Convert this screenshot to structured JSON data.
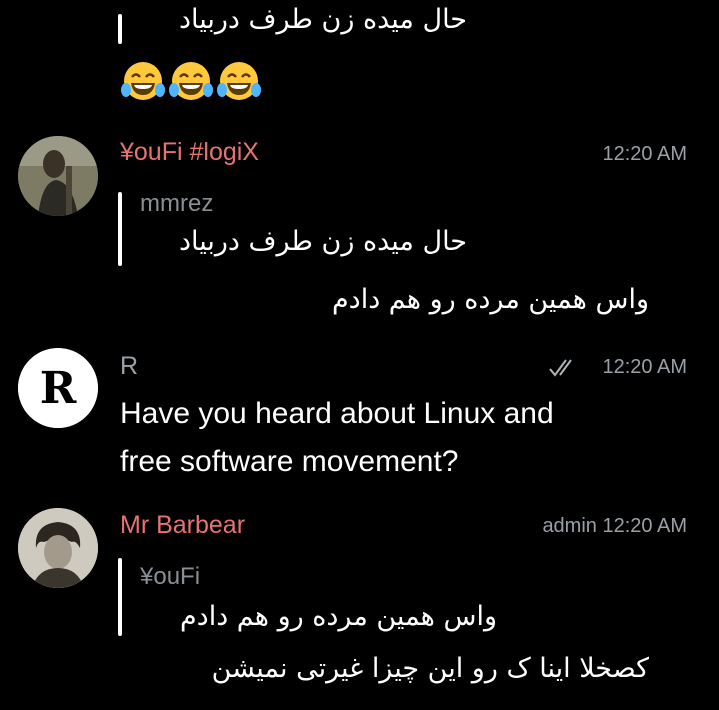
{
  "top_partial": {
    "text": "حال میده زن طرف دربیاد",
    "emoji": "😂😂😂"
  },
  "messages": [
    {
      "sender": "¥ouFi #logiX",
      "sender_color": "#e57373",
      "time": "12:20 AM",
      "reply_name": "mmrez",
      "reply_text": "حال میده زن طرف دربیاد",
      "text": "واس همین مرده رو هم دادم"
    },
    {
      "sender": "R",
      "sender_color": "#9aa0a6",
      "time": "12:20 AM",
      "status_icon": "double-check-icon",
      "avatar_letter": "R",
      "line1": "Have you heard about Linux and",
      "line2": "free software movement?"
    },
    {
      "sender": "Mr Barbear",
      "sender_color": "#e57373",
      "badge": "admin",
      "time": "12:20 AM",
      "reply_name": "¥ouFi",
      "reply_text": "واس همین مرده رو هم دادم",
      "text": "کصخلا اینا ک رو این چیزا غیرتی نمیشن"
    }
  ]
}
